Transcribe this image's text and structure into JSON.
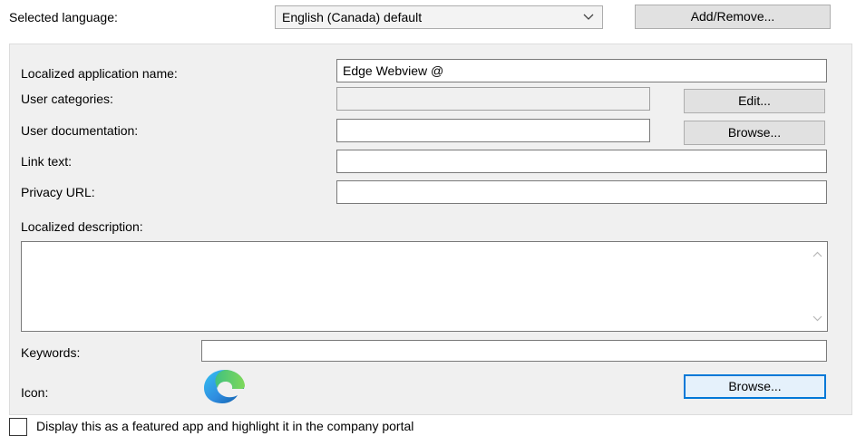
{
  "language": {
    "label": "Selected language:",
    "selected": "English (Canada) default",
    "add_remove_label": "Add/Remove..."
  },
  "form": {
    "app_name_label": "Localized application name:",
    "app_name_value": "Edge Webview @",
    "user_categories_label": "User categories:",
    "user_categories_value": "",
    "edit_label": "Edit...",
    "user_documentation_label": "User documentation:",
    "user_documentation_value": "",
    "browse_doc_label": "Browse...",
    "link_text_label": "Link text:",
    "link_text_value": "",
    "privacy_url_label": "Privacy URL:",
    "privacy_url_value": "",
    "description_label": "Localized description:",
    "keywords_label": "Keywords:",
    "keywords_value": "",
    "icon_label": "Icon:",
    "icon_name": "edge-logo-icon",
    "browse_icon_label": "Browse..."
  },
  "featured": {
    "label": "Display this as a featured app and highlight it in the company portal",
    "checked": false
  },
  "colors": {
    "accent": "#0078d7",
    "panel_bg": "#f0f0f0"
  }
}
